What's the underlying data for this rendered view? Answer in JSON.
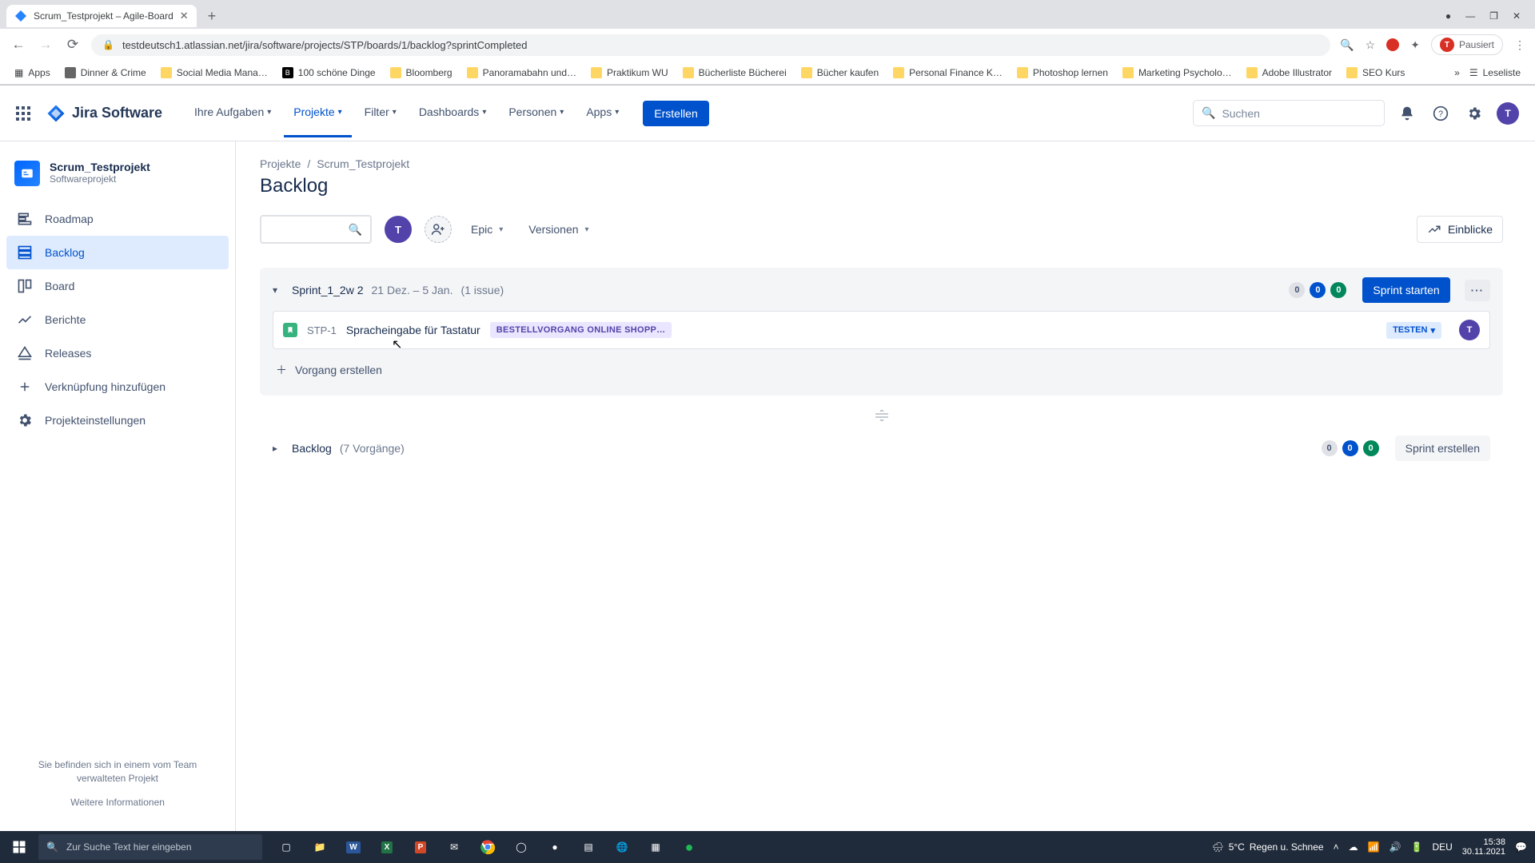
{
  "browser": {
    "tab_title": "Scrum_Testprojekt – Agile-Board",
    "url": "testdeutsch1.atlassian.net/jira/software/projects/STP/boards/1/backlog?sprintCompleted",
    "profile_status": "Pausiert",
    "bookmarks": [
      "Apps",
      "Dinner & Crime",
      "Social Media Mana…",
      "100 schöne Dinge",
      "Bloomberg",
      "Panoramabahn und…",
      "Praktikum WU",
      "Bücherliste Bücherei",
      "Bücher kaufen",
      "Personal Finance K…",
      "Photoshop lernen",
      "Marketing Psycholo…",
      "Adobe Illustrator",
      "SEO Kurs"
    ],
    "reading_list": "Leseliste"
  },
  "nav": {
    "logo": "Jira Software",
    "items": [
      {
        "label": "Ihre Aufgaben"
      },
      {
        "label": "Projekte"
      },
      {
        "label": "Filter"
      },
      {
        "label": "Dashboards"
      },
      {
        "label": "Personen"
      },
      {
        "label": "Apps"
      }
    ],
    "create": "Erstellen",
    "search_placeholder": "Suchen"
  },
  "sidebar": {
    "project_name": "Scrum_Testprojekt",
    "project_type": "Softwareprojekt",
    "items": [
      {
        "label": "Roadmap"
      },
      {
        "label": "Backlog"
      },
      {
        "label": "Board"
      },
      {
        "label": "Berichte"
      },
      {
        "label": "Releases"
      },
      {
        "label": "Verknüpfung hinzufügen"
      },
      {
        "label": "Projekteinstellungen"
      }
    ],
    "footer_text": "Sie befinden sich in einem vom Team verwalteten Projekt",
    "footer_link": "Weitere Informationen"
  },
  "main": {
    "breadcrumb": {
      "root": "Projekte",
      "project": "Scrum_Testprojekt"
    },
    "title": "Backlog",
    "filters": {
      "epic": "Epic",
      "versions": "Versionen"
    },
    "insights": "Einblicke",
    "sprint": {
      "name": "Sprint_1_2w 2",
      "dates": "21 Dez. – 5 Jan.",
      "count": "(1 issue)",
      "badges": [
        "0",
        "0",
        "0"
      ],
      "start_label": "Sprint starten",
      "issue": {
        "key": "STP-1",
        "summary": "Spracheingabe für Tastatur",
        "epic": "BESTELLVORGANG ONLINE SHOPP…",
        "status": "TESTEN"
      },
      "create_issue": "Vorgang erstellen"
    },
    "backlog": {
      "name": "Backlog",
      "count": "(7 Vorgänge)",
      "badges": [
        "0",
        "0",
        "0"
      ],
      "create_sprint": "Sprint erstellen"
    }
  },
  "taskbar": {
    "search_placeholder": "Zur Suche Text hier eingeben",
    "weather_temp": "5°C",
    "weather_text": "Regen u. Schnee",
    "lang": "DEU",
    "time": "15:38",
    "date": "30.11.2021"
  },
  "user": {
    "initial": "T"
  }
}
